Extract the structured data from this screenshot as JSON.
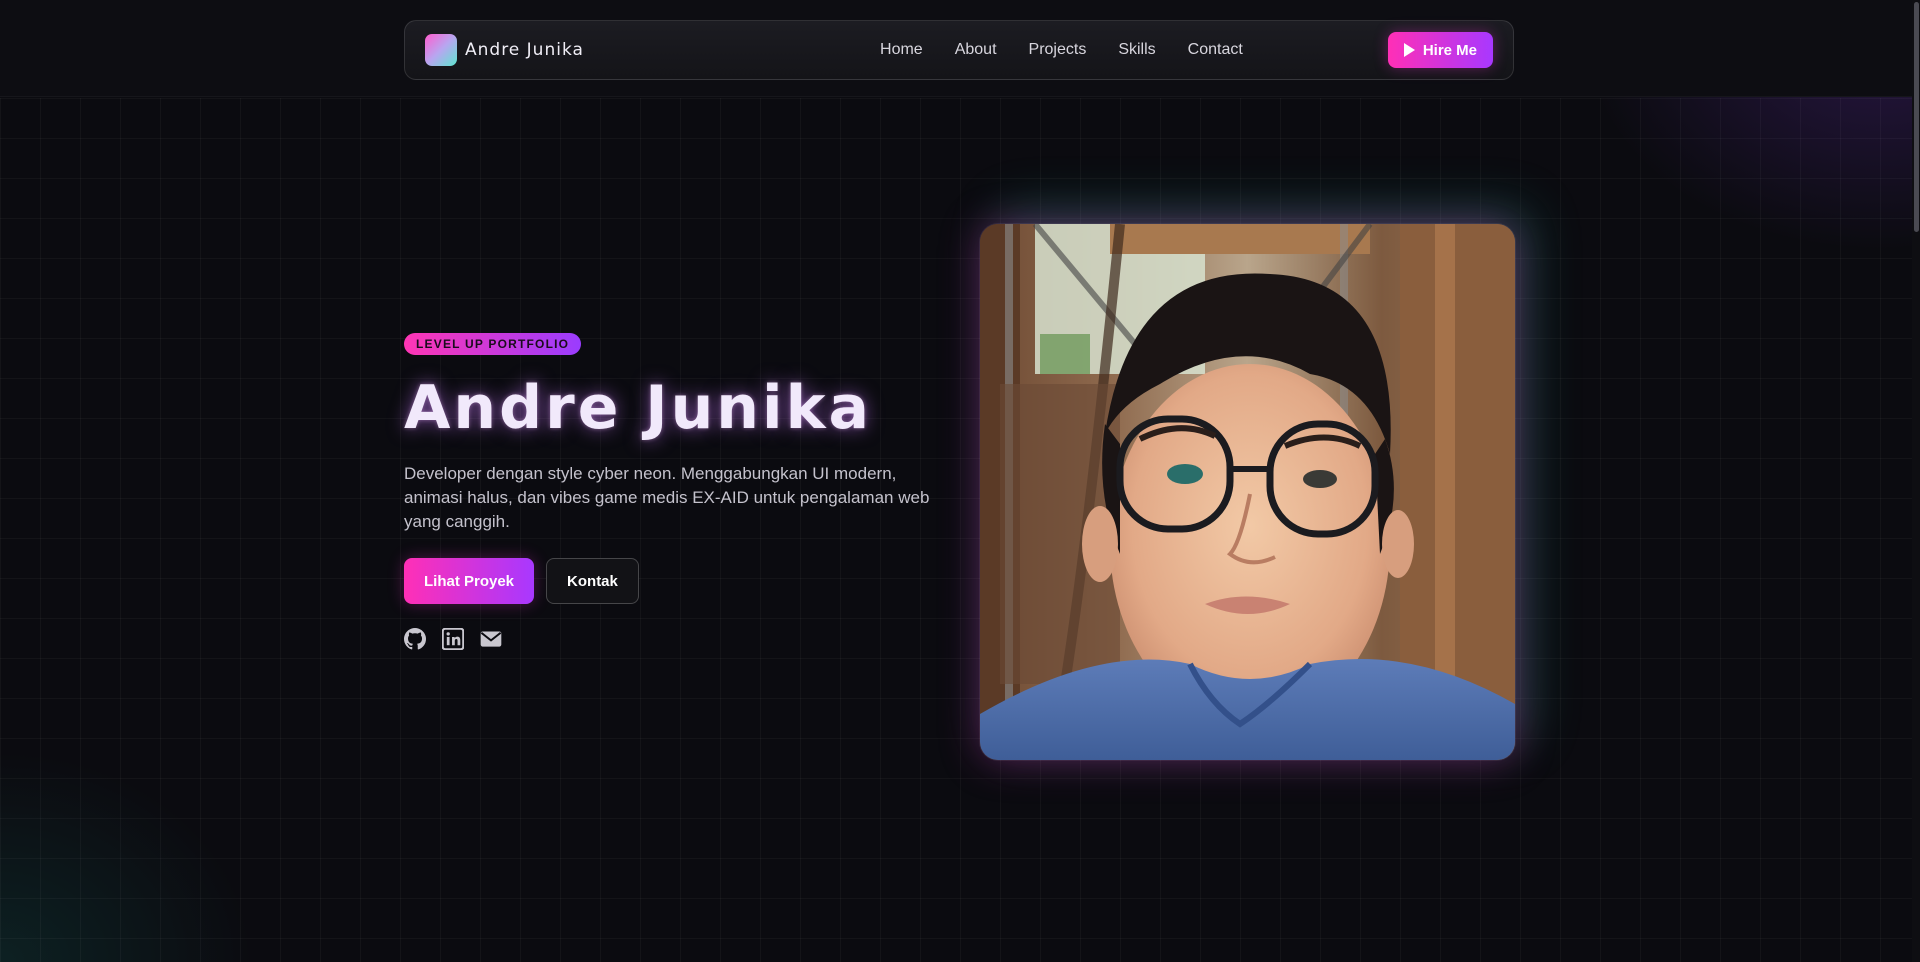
{
  "nav": {
    "brand": "Andre Junika",
    "links": [
      "Home",
      "About",
      "Projects",
      "Skills",
      "Contact"
    ],
    "cta": "Hire Me",
    "cta_icon": "play-icon"
  },
  "hero": {
    "badge": "LEVEL UP PORTFOLIO",
    "title": "Andre Junika",
    "description": "Developer dengan style cyber neon. Menggabungkan UI modern, animasi halus, dan vibes game medis EX-AID untuk pengalaman web yang canggih.",
    "primary_button": "Lihat Proyek",
    "secondary_button": "Kontak",
    "socials": [
      "github-icon",
      "linkedin-icon",
      "mail-icon"
    ]
  },
  "colors": {
    "accent_pink": "#ff2fb6",
    "accent_purple": "#a838ff",
    "accent_teal": "#5de6d0",
    "background": "#0b0b10"
  }
}
